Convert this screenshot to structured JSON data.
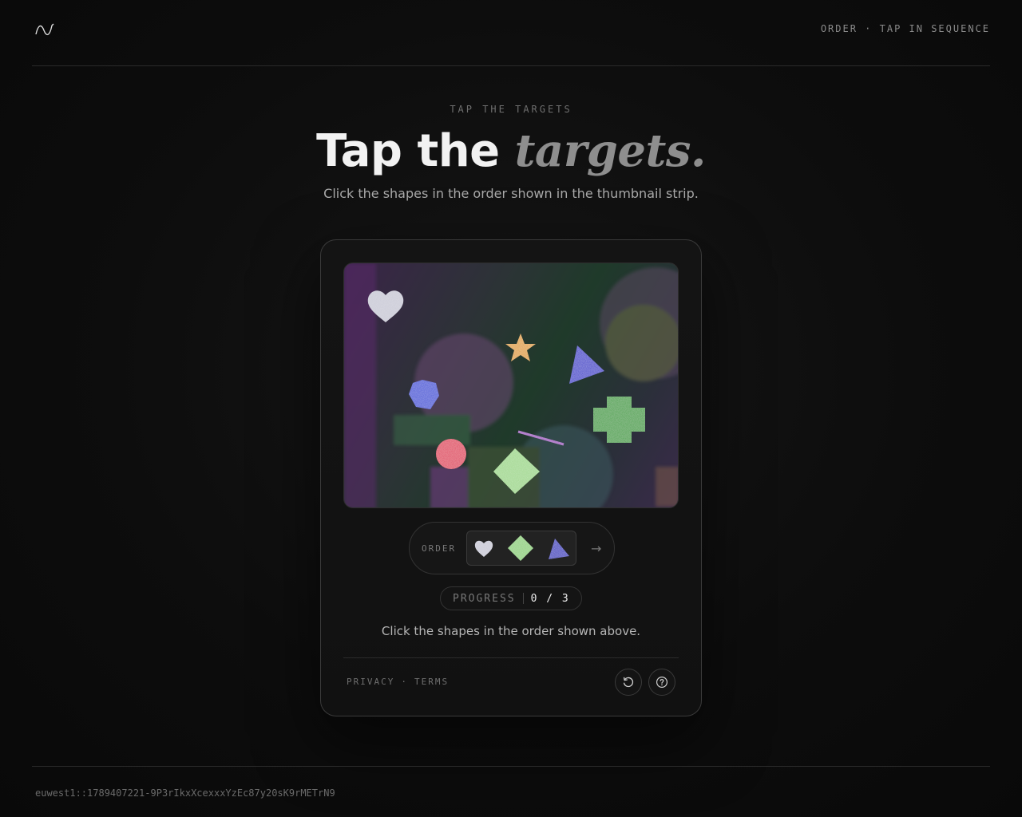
{
  "header": {
    "logo_icon": "wave-logo-icon",
    "tagline": "ORDER · TAP IN SEQUENCE"
  },
  "hero": {
    "eyebrow": "TAP THE TARGETS",
    "headline_main": "Tap the",
    "headline_accent": "targets.",
    "subtitle": "Click the shapes in the order shown in the thumbnail strip."
  },
  "challenge": {
    "canvas_shapes": [
      {
        "shape": "heart",
        "color": "#c9c9d6"
      },
      {
        "shape": "star",
        "color": "#e0a030"
      },
      {
        "shape": "triangle",
        "color": "#3a3acc"
      },
      {
        "shape": "hexagon",
        "color": "#3a4ed8"
      },
      {
        "shape": "cross",
        "color": "#3aa03a"
      },
      {
        "shape": "circle",
        "color": "#e03a5a"
      },
      {
        "shape": "diamond",
        "color": "#9ed88a"
      }
    ],
    "order_label": "ORDER",
    "order_sequence": [
      {
        "shape": "heart",
        "icon": "heart-icon",
        "color": "#c9c9d6"
      },
      {
        "shape": "diamond",
        "icon": "diamond-icon",
        "color": "#8ed07a"
      },
      {
        "shape": "triangle",
        "icon": "triangle-icon",
        "color": "#2f2fc0"
      }
    ],
    "arrow_icon": "arrow-right-icon",
    "arrow_glyph": "→",
    "progress_label": "PROGRESS",
    "progress_value": "0 / 3",
    "progress_fraction": 0,
    "instruction": "Click the shapes in the order shown above."
  },
  "card_footer": {
    "privacy_label": "PRIVACY",
    "separator": "·",
    "terms_label": "TERMS",
    "refresh_icon": "refresh-icon",
    "help_icon": "help-icon"
  },
  "footer": {
    "session_id": "euwest1::1789407221-9P3rIkxXcexxxYzEc87y20sK9rMETrN9"
  }
}
